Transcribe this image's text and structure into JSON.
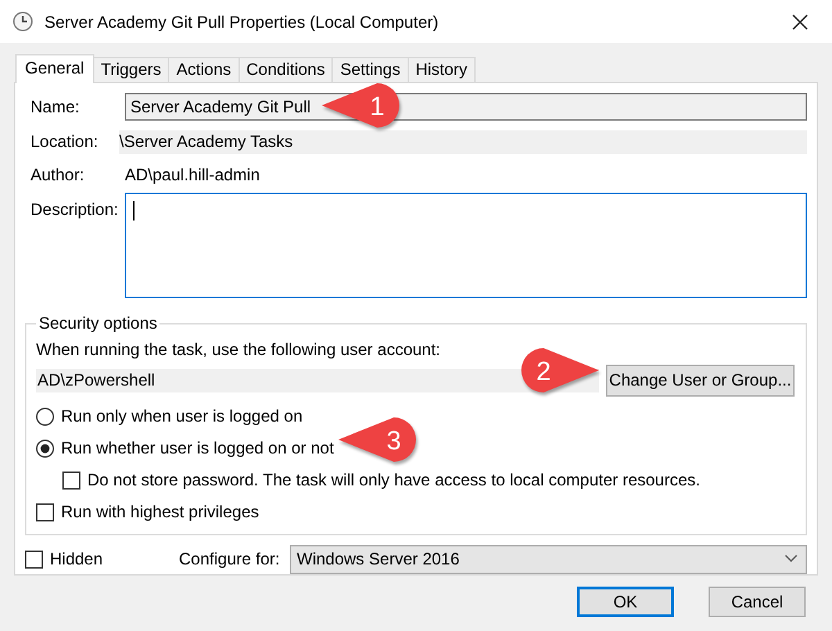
{
  "window": {
    "title": "Server Academy Git Pull Properties (Local Computer)"
  },
  "tabs": [
    {
      "label": "General",
      "selected": true
    },
    {
      "label": "Triggers",
      "selected": false
    },
    {
      "label": "Actions",
      "selected": false
    },
    {
      "label": "Conditions",
      "selected": false
    },
    {
      "label": "Settings",
      "selected": false
    },
    {
      "label": "History",
      "selected": false
    }
  ],
  "fields": [
    {
      "kind": "input",
      "label": "Name:",
      "value": "Server Academy Git Pull"
    },
    {
      "kind": "readonly",
      "label": "Location:",
      "value": "\\Server Academy Tasks"
    },
    {
      "kind": "plain",
      "label": "Author:",
      "value": "AD\\paul.hill-admin"
    },
    {
      "kind": "textarea",
      "label": "Description:",
      "focused": true
    }
  ],
  "security": {
    "title": "Security options",
    "account_prompt": "When running the task, use the following user account:",
    "account": "AD\\zPowershell",
    "change_button": "Change User or Group...",
    "options": [
      {
        "kind": "radio",
        "label": "Run only when user is logged on",
        "selected": false
      },
      {
        "kind": "radio",
        "label": "Run whether user is logged on or not",
        "selected": true,
        "children": [
          {
            "kind": "checkbox",
            "label": "Do not store password.  The task will only have access to local computer resources.",
            "checked": false
          }
        ]
      },
      {
        "kind": "checkbox",
        "label": "Run with highest privileges",
        "checked": false
      }
    ]
  },
  "hidden": {
    "label": "Hidden",
    "checked": false
  },
  "configure": {
    "label": "Configure for:",
    "value": "Windows Server 2016"
  },
  "buttons": [
    {
      "label": "OK",
      "default": true
    },
    {
      "label": "Cancel",
      "default": false
    }
  ],
  "callouts": [
    {
      "text": "1",
      "kind": "left"
    },
    {
      "text": "2",
      "kind": "right"
    },
    {
      "text": "3",
      "kind": "left"
    }
  ]
}
